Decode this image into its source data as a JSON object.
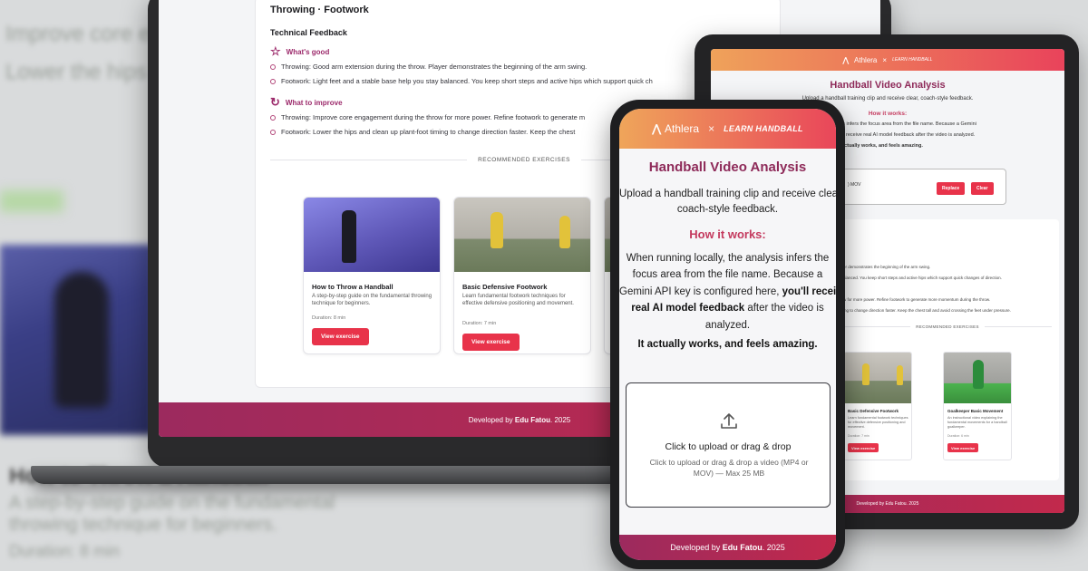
{
  "background": {
    "blur_texts": [
      "Improve core en",
      "Lower the hips c",
      "A step-by-step guide on the fundamental",
      "throwing technique for beginners.",
      "Duration: 8 min",
      "How to Throw a Handball"
    ]
  },
  "laptop": {
    "section_heading": "Throwing · Footwork",
    "technical_feedback": "Technical Feedback",
    "whats_good_label": "What's good",
    "whats_good": [
      "Throwing: Good arm extension during the throw. Player demonstrates the beginning of the arm swing.",
      "Footwork: Light feet and a stable base help you stay balanced. You keep short steps and active hips which support quick ch"
    ],
    "improve_label": "What to improve",
    "improve": [
      "Throwing: Improve core engagement during the throw for more power. Refine footwork to generate m",
      "Footwork: Lower the hips and clean up plant-foot timing to change direction faster. Keep the chest"
    ],
    "recommended_label": "RECOMMENDED EXERCISES",
    "exercises": [
      {
        "title": "How to Throw a Handball",
        "desc": "A step-by-step guide on the fundamental throwing technique for beginners.",
        "duration": "Duration: 8 min",
        "button": "View exercise"
      },
      {
        "title": "Basic Defensive Footwork",
        "desc": "Learn fundamental footwork techniques for effective defensive positioning and movement.",
        "duration": "Duration: 7 min",
        "button": "View exercise"
      }
    ],
    "footer_prefix": "Developed by ",
    "footer_name": "Edu Fatou",
    "footer_suffix": ". 2025"
  },
  "tablet": {
    "brand": "Athlera",
    "partner": "LEARN HANDBALL",
    "title": "Handball Video Analysis",
    "upload_text": "Upload a handball training clip and receive clear, coach-style feedback.",
    "how_it_works": "How it works:",
    "para_lines": [
      "is infers the focus area from the file name. Because a Gemini",
      "'ll receive real AI model feedback after the video is analyzed.",
      "actually works, and feels amazing."
    ],
    "file_name": ") MOV",
    "replace_button": "Replace",
    "clear_button": "Clear",
    "feedback_lines": [
      "er demonstrates the beginning of the arm swing.",
      "alanced. You keep short steps and active hips which support quick changes of direction.",
      "w for more power. Refine footwork to generate more momentum during the throw.",
      "ing to change direction faster. Keep the chest tall and avoid crossing the feet under pressure."
    ],
    "recommended_label": "RECOMMENDED EXERCISES",
    "exercises": [
      {
        "title": "Basic Defensive Footwork",
        "desc": "Learn fundamental footwork techniques for effective defensive positioning and movement.",
        "duration": "Duration: 7 min",
        "button": "View exercise"
      },
      {
        "title": "Goalkeeper Basic Movement",
        "desc": "An instructional video explaining the fundamental movements for a handball goalkeeper.",
        "duration": "Duration: 6 min",
        "button": "View exercise"
      }
    ],
    "footer": "Developed by Edu Fatou. 2025"
  },
  "phone": {
    "brand": "Athlera",
    "separator": "×",
    "partner": "LEARN HANDBALL",
    "title": "Handball Video Analysis",
    "intro_line1": "Upload a handball training clip and receive clear,",
    "intro_line2": "coach-style feedback.",
    "how_it_works": "How it works:",
    "body_line1": "When running locally, the analysis infers the",
    "body_line2": "focus area from the file name. Because a",
    "body_line3a": "Gemini API key is configured here, ",
    "body_line3b": "you'll receive",
    "body_line4a": "real AI model feedback",
    "body_line4b": " after the video is",
    "body_line5": "analyzed.",
    "amazing": "It actually works, and feels amazing.",
    "drop_main": "Click to upload or drag & drop",
    "drop_sub": "Click to upload or drag & drop a video (MP4 or MOV) — Max 25 MB",
    "footer_prefix": "Developed by ",
    "footer_name": "Edu Fatou",
    "footer_suffix": ". 2025"
  },
  "colors": {
    "accent_red": "#e8334a",
    "title_purple": "#8e2a59",
    "header_gradient_start": "#efa55a",
    "header_gradient_end": "#e9465a",
    "footer_gradient_start": "#9c2a5e",
    "footer_gradient_end": "#c2294c"
  }
}
